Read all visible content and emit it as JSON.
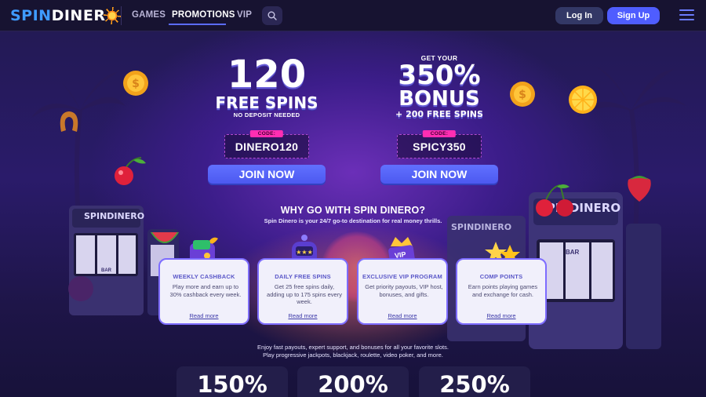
{
  "nav": {
    "logo_part1": "SPIN",
    "logo_part2": "DINER",
    "links": [
      "GAMES",
      "PROMOTIONS",
      "VIP"
    ],
    "active_link": "PROMOTIONS",
    "login_label": "Log In",
    "signup_label": "Sign Up"
  },
  "promo_left": {
    "amount": "120",
    "headline": "FREE SPINS",
    "sub": "NO DEPOSIT NEEDED",
    "code_label": "CODE:",
    "code": "DINERO120",
    "cta": "JOIN NOW"
  },
  "promo_right": {
    "pre": "GET YOUR",
    "amount": "350%",
    "headline": "BONUS",
    "sub": "+ 200 FREE SPINS",
    "code_label": "CODE:",
    "code": "SPICY350",
    "cta": "JOIN NOW"
  },
  "why": {
    "title": "WHY GO WITH SPIN DINERO?",
    "subtitle": "Spin Dinero is your 24/7 go-to destination for real money thrills."
  },
  "features": [
    {
      "title": "WEEKLY CASHBACK",
      "desc": "Play more and earn up to 30% cashback every week.",
      "link": "Read more"
    },
    {
      "title": "DAILY FREE SPINS",
      "desc": "Get 25 free spins daily, adding up to 175 spins every week.",
      "link": "Read more"
    },
    {
      "title": "EXCLUSIVE VIP PROGRAM",
      "desc": "Get priority payouts, VIP host, bonuses, and gifts.",
      "link": "Read more"
    },
    {
      "title": "COMP POINTS",
      "desc": "Earn points playing games and exchange for cash.",
      "link": "Read more"
    }
  ],
  "bottom": {
    "line1": "Enjoy fast payouts, expert support, and bonuses for all your favorite slots.",
    "line2": "Play progressive jackpots, blackjack, roulette, video poker, and more."
  },
  "percent_cards": [
    "150%",
    "200%",
    "250%"
  ],
  "machine_labels": [
    "SPINDINERO",
    "SPINDINERO",
    "SPINDINERO"
  ],
  "reel_labels": [
    "BAR",
    "BAR"
  ],
  "vip_badge": "VIP",
  "colors": {
    "primary": "#4f5dff",
    "code_tag": "#ff2eb2",
    "background": "#1a1236",
    "card_border": "#7d6cff"
  },
  "icons": [
    "sun-logo-icon",
    "search-icon",
    "hamburger-menu-icon",
    "coin-icon",
    "cherry-icon",
    "lemon-icon",
    "strawberry-icon",
    "watermelon-icon",
    "wallet-cashback-icon",
    "slot-robot-icon",
    "vip-crown-icon",
    "stars-icon"
  ]
}
